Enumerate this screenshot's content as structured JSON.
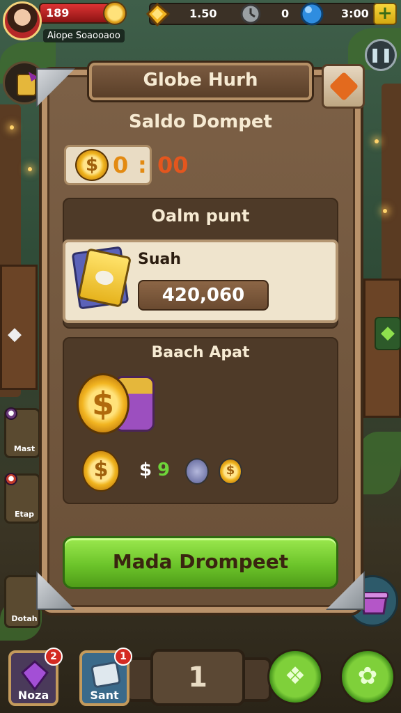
{
  "top": {
    "hp": "189",
    "player_name": "Aiope Soaooaoo",
    "res1": "1.50",
    "res2": "0",
    "res3": "3:00",
    "plus": "+"
  },
  "panel": {
    "title": "Globe Hurh",
    "balance_heading": "Saldo Dompet",
    "balance_a": "0",
    "balance_sep": ":",
    "balance_b": "00",
    "section1_heading": "Oalm punt",
    "card_label": "Suah",
    "card_amount": "420,060",
    "section2_heading": "Baach Apat",
    "coin_symbol": "$",
    "denom_dollar": "$",
    "denom_9": "9",
    "action_button": "Mada Drompeet"
  },
  "side_left": [
    {
      "label": "Mast"
    },
    {
      "label": "Etap"
    },
    {
      "label": "Dotah"
    }
  ],
  "bottom": {
    "item1_label": "Noza",
    "item1_badge": "2",
    "item2_label": "Sant",
    "item2_badge": "1",
    "center_value": "1"
  },
  "colors": {
    "accent_green": "#6cc42a",
    "panel_brown": "#6a5038",
    "gold": "#f2b521",
    "balance_orange": "#e36a1e"
  },
  "icons": [
    "avatar",
    "coin-icon",
    "gem-icon",
    "clock-icon",
    "blue-orb-icon",
    "pause-icon",
    "heart-icon",
    "cards-icon",
    "coin-stack-icon",
    "leaf-icon",
    "gear-icon"
  ]
}
